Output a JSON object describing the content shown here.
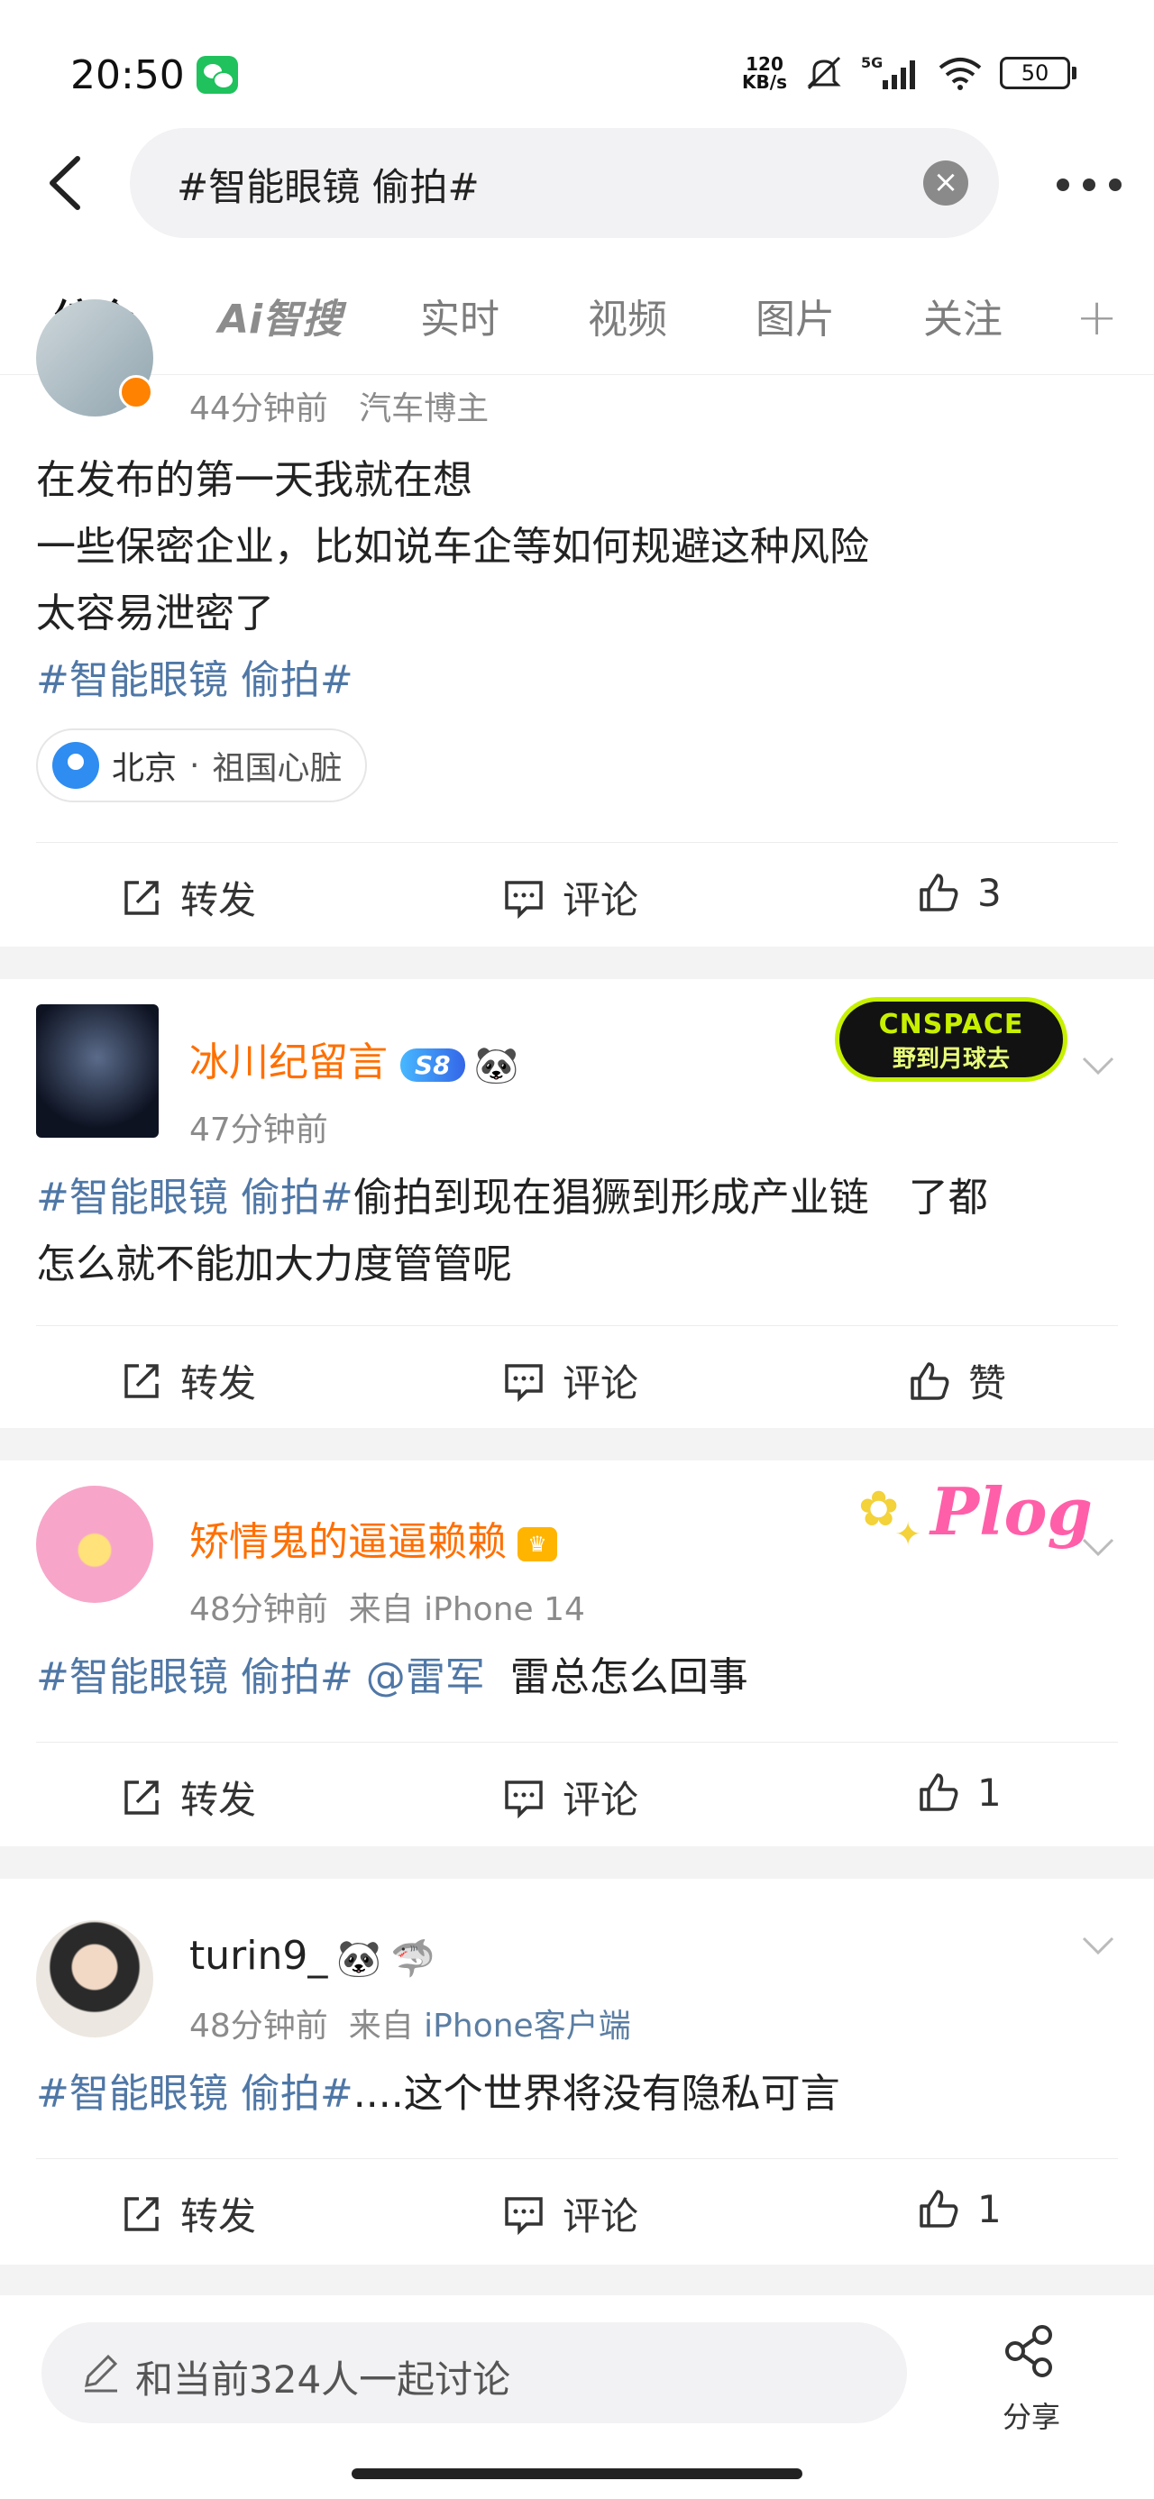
{
  "status_bar": {
    "time": "20:50",
    "net_speed_value": "120",
    "net_speed_unit": "KB/s",
    "signal": "5G",
    "battery": "50"
  },
  "search": {
    "query": "#智能眼镜 偷拍#"
  },
  "tabs": [
    "综合",
    "Ai智搜",
    "实时",
    "视频",
    "图片",
    "关注"
  ],
  "posts": [
    {
      "time": "44分钟前",
      "source": "汽车博主",
      "lines": [
        "在发布的第一天我就在想",
        "一些保密企业，比如说车企等如何规避这种风险",
        "太容易泄密了"
      ],
      "hashtag": "#智能眼镜 偷拍#",
      "location": "北京",
      "location_sep": "·",
      "location_desc": "祖国心脏",
      "repost": "转发",
      "comment": "评论",
      "like": "3"
    },
    {
      "name": "冰川纪留言",
      "badge": "S8",
      "time": "47分钟前",
      "hashtag": "#智能眼镜 偷拍#",
      "text_a": "偷拍到现在猖獗到形成产业链　了都",
      "text_b": "怎么就不能加大力度管管呢",
      "decor_line1": "CNSPACE",
      "decor_line2": "野到月球去",
      "repost": "转发",
      "comment": "评论",
      "like": "赞"
    },
    {
      "name": "矫情鬼的逼逼赖赖",
      "time": "48分钟前",
      "from": "来自 iPhone 14",
      "hashtag": "#智能眼镜 偷拍#",
      "mention": "@雷军",
      "text": "雷总怎么回事",
      "decor_text": "Plog",
      "repost": "转发",
      "comment": "评论",
      "like": "1"
    },
    {
      "name": "turin9_",
      "time": "48分钟前",
      "from_prefix": "来自",
      "from_source": "iPhone客户端",
      "hashtag": "#智能眼镜 偷拍#",
      "text": "....这个世界将没有隐私可言",
      "repost": "转发",
      "comment": "评论",
      "like": "1"
    }
  ],
  "bottom": {
    "discuss_placeholder": "和当前324人一起讨论",
    "share": "分享"
  }
}
